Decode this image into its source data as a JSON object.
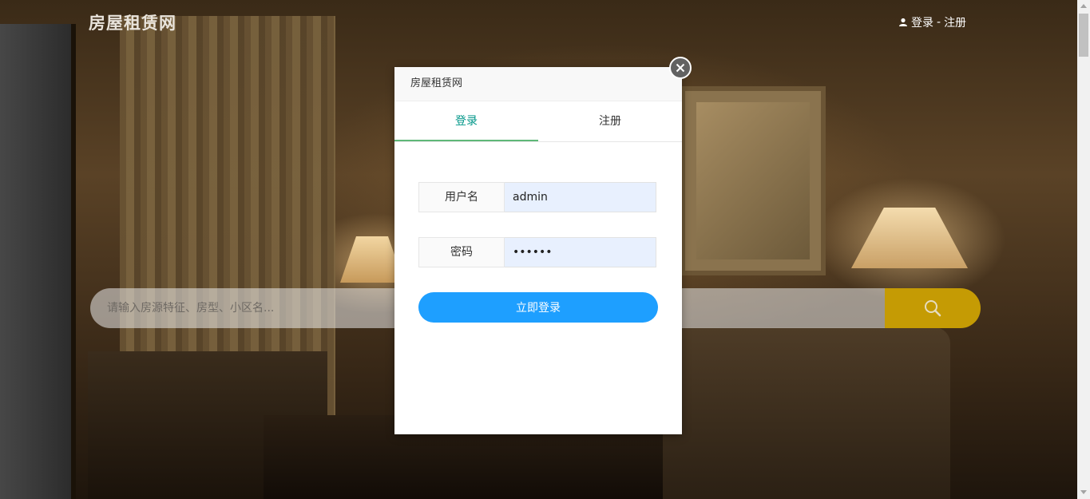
{
  "header": {
    "site_title": "房屋租赁网",
    "login_link": "登录",
    "separator": "-",
    "register_link": "注册"
  },
  "search": {
    "placeholder": "请输入房源特征、房型、小区名..."
  },
  "modal": {
    "title": "房屋租赁网",
    "tabs": [
      {
        "label": "登录",
        "active": true
      },
      {
        "label": "注册",
        "active": false
      }
    ],
    "form": {
      "username_label": "用户名",
      "username_value": "admin",
      "password_label": "密码",
      "password_value": "••••••",
      "submit_label": "立即登录"
    }
  },
  "colors": {
    "accent_tab": "#009688",
    "submit": "#1e9fff",
    "search_button": "#c59b04"
  }
}
